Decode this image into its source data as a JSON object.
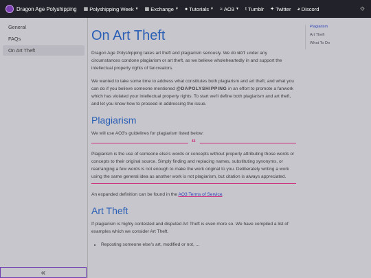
{
  "topbar": {
    "brand": "Dragon Age Polyshipping",
    "nav": [
      {
        "label": "Polyshipping Week",
        "icon": "calendar-icon",
        "dropdown": true
      },
      {
        "label": "Exchange",
        "icon": "gift-icon",
        "dropdown": true
      },
      {
        "label": "Tutorials",
        "icon": "question-icon",
        "dropdown": true
      },
      {
        "label": "AO3",
        "icon": "ao3-icon",
        "dropdown": true
      },
      {
        "label": "Tumblr",
        "icon": "tumblr-icon",
        "dropdown": false
      },
      {
        "label": "Twitter",
        "icon": "twitter-icon",
        "dropdown": false
      },
      {
        "label": "Discord",
        "icon": "discord-icon",
        "dropdown": false
      }
    ]
  },
  "sidebar": {
    "items": [
      {
        "label": "General"
      },
      {
        "label": "FAQs"
      },
      {
        "label": "On Art Theft"
      }
    ],
    "collapse_label": "«"
  },
  "main": {
    "title": "On Art Theft",
    "intro1_a": "Dragon Age Polyshipping takes art theft and plagiarism seriously. We do ",
    "intro1_not": "not",
    "intro1_b": " under any circumstances condone plagiarism or art theft, as we believe wholeheartedly in and support the intellectual property rights of fancreators.",
    "intro2_a": "We wanted to take some time to address what constitutes both plagiarism and art theft, and what you can do if you believe someone mentioned ",
    "intro2_handle": "@DAPOLYSHIPPING",
    "intro2_b": " in an effort to promote a fanwork which has violated your intellectual property rights. To start we'll define both plagiarism and art theft, and let you know how to proceed in addressing the issue.",
    "plagiarism_heading": "Plagiarism",
    "plagiarism_p1": "We will use AO3's guidelines for plagiarism listed below:",
    "quote_mark": "“",
    "quote_text": "Plagiarism is the use of someone else's words or concepts without properly attributing those words or concepts to their original source. Simply finding and replacing names, substituting synonyms, or rearranging a few words is not enough to make the work original to you. Deliberately writing a work using the same general idea as another work is not plagiarism, but citation is always appreciated.",
    "expanded_a": "An expanded definition can be found in the ",
    "expanded_link": "AO3 Terms of Service",
    "expanded_b": ".",
    "arttheft_heading": "Art Theft",
    "arttheft_p1": "If plagiarism is highly contested and disputed Art Theft is even more so. We have compiled a list of examples which we consider Art Theft.",
    "list_items": [
      "Reposting someone else's art, modified or not, ..."
    ]
  },
  "toc": {
    "items": [
      "Plagiarism",
      "Art Theft",
      "What To Do"
    ]
  }
}
